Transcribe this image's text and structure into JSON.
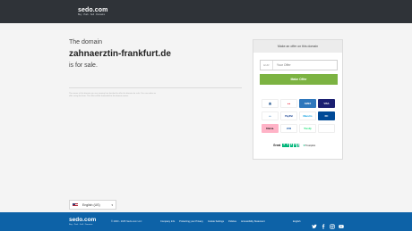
{
  "header": {
    "logo_main": "sedo.com",
    "logo_sub": "Buy · Park · Sell · Domains"
  },
  "main": {
    "intro": "The domain",
    "domain": "zahnaerztin-frankfurt.de",
    "status": "is for sale.",
    "disclaimer": "The owner of the domain you are viewing has decided to offer the domain for sale. You can make an offer using the form. The offer will be forwarded to the domain owner."
  },
  "offer_panel": {
    "title": "Make an offer on this domain",
    "currency": "EUR",
    "offer_placeholder": "Your Offer",
    "button_label": "Make Offer",
    "payments": [
      {
        "name": "bank-transfer-icon",
        "label": "🏛",
        "bg": "#ffffff",
        "fg": "#1a4f8b"
      },
      {
        "name": "mastercard-icon",
        "label": "●●",
        "bg": "#ffffff",
        "fg": "#eb001b"
      },
      {
        "name": "american-express-icon",
        "label": "AMEX",
        "bg": "#2e77bc",
        "fg": "#ffffff"
      },
      {
        "name": "visa-icon",
        "label": "VISA",
        "bg": "#1a1f71",
        "fg": "#ffffff"
      },
      {
        "name": "credit-card-icon",
        "label": "▭",
        "bg": "#ffffff",
        "fg": "#2a6fb0"
      },
      {
        "name": "paypal-icon",
        "label": "PayPal",
        "bg": "#ffffff",
        "fg": "#003087"
      },
      {
        "name": "maestro-icon",
        "label": "Maestro",
        "bg": "#ffffff",
        "fg": "#0099df"
      },
      {
        "name": "diners-club-icon",
        "label": "DC",
        "bg": "#004a97",
        "fg": "#ffffff"
      },
      {
        "name": "klarna-icon",
        "label": "Klarna.",
        "bg": "#ffb3c7",
        "fg": "#111111"
      },
      {
        "name": "jcb-icon",
        "label": "JCB",
        "bg": "#ffffff",
        "fg": "#0b4ea2"
      },
      {
        "name": "trustly-icon",
        "label": "Trustly",
        "bg": "#ffffff",
        "fg": "#0ee06e"
      },
      {
        "name": "blank-payment-icon",
        "label": "",
        "bg": "#ffffff",
        "fg": "#ffffff"
      }
    ],
    "trust_label": "Great",
    "trust_brand": "Trustpilot"
  },
  "language": {
    "current": "English (US)"
  },
  "footer": {
    "logo_main": "sedo.com",
    "logo_sub": "Buy · Park · Sell · Domains",
    "copyright": "© 2000 - 2025 Sedo.com LLC",
    "links": [
      "Company Info",
      "Protecting your Privacy",
      "Cookie Settings",
      "Policies",
      "Accessibility Statement"
    ],
    "footer_lang": "English"
  },
  "colors": {
    "topbar": "#2f3338",
    "accent_green": "#7cb342",
    "footer_blue": "#0d62a7"
  }
}
